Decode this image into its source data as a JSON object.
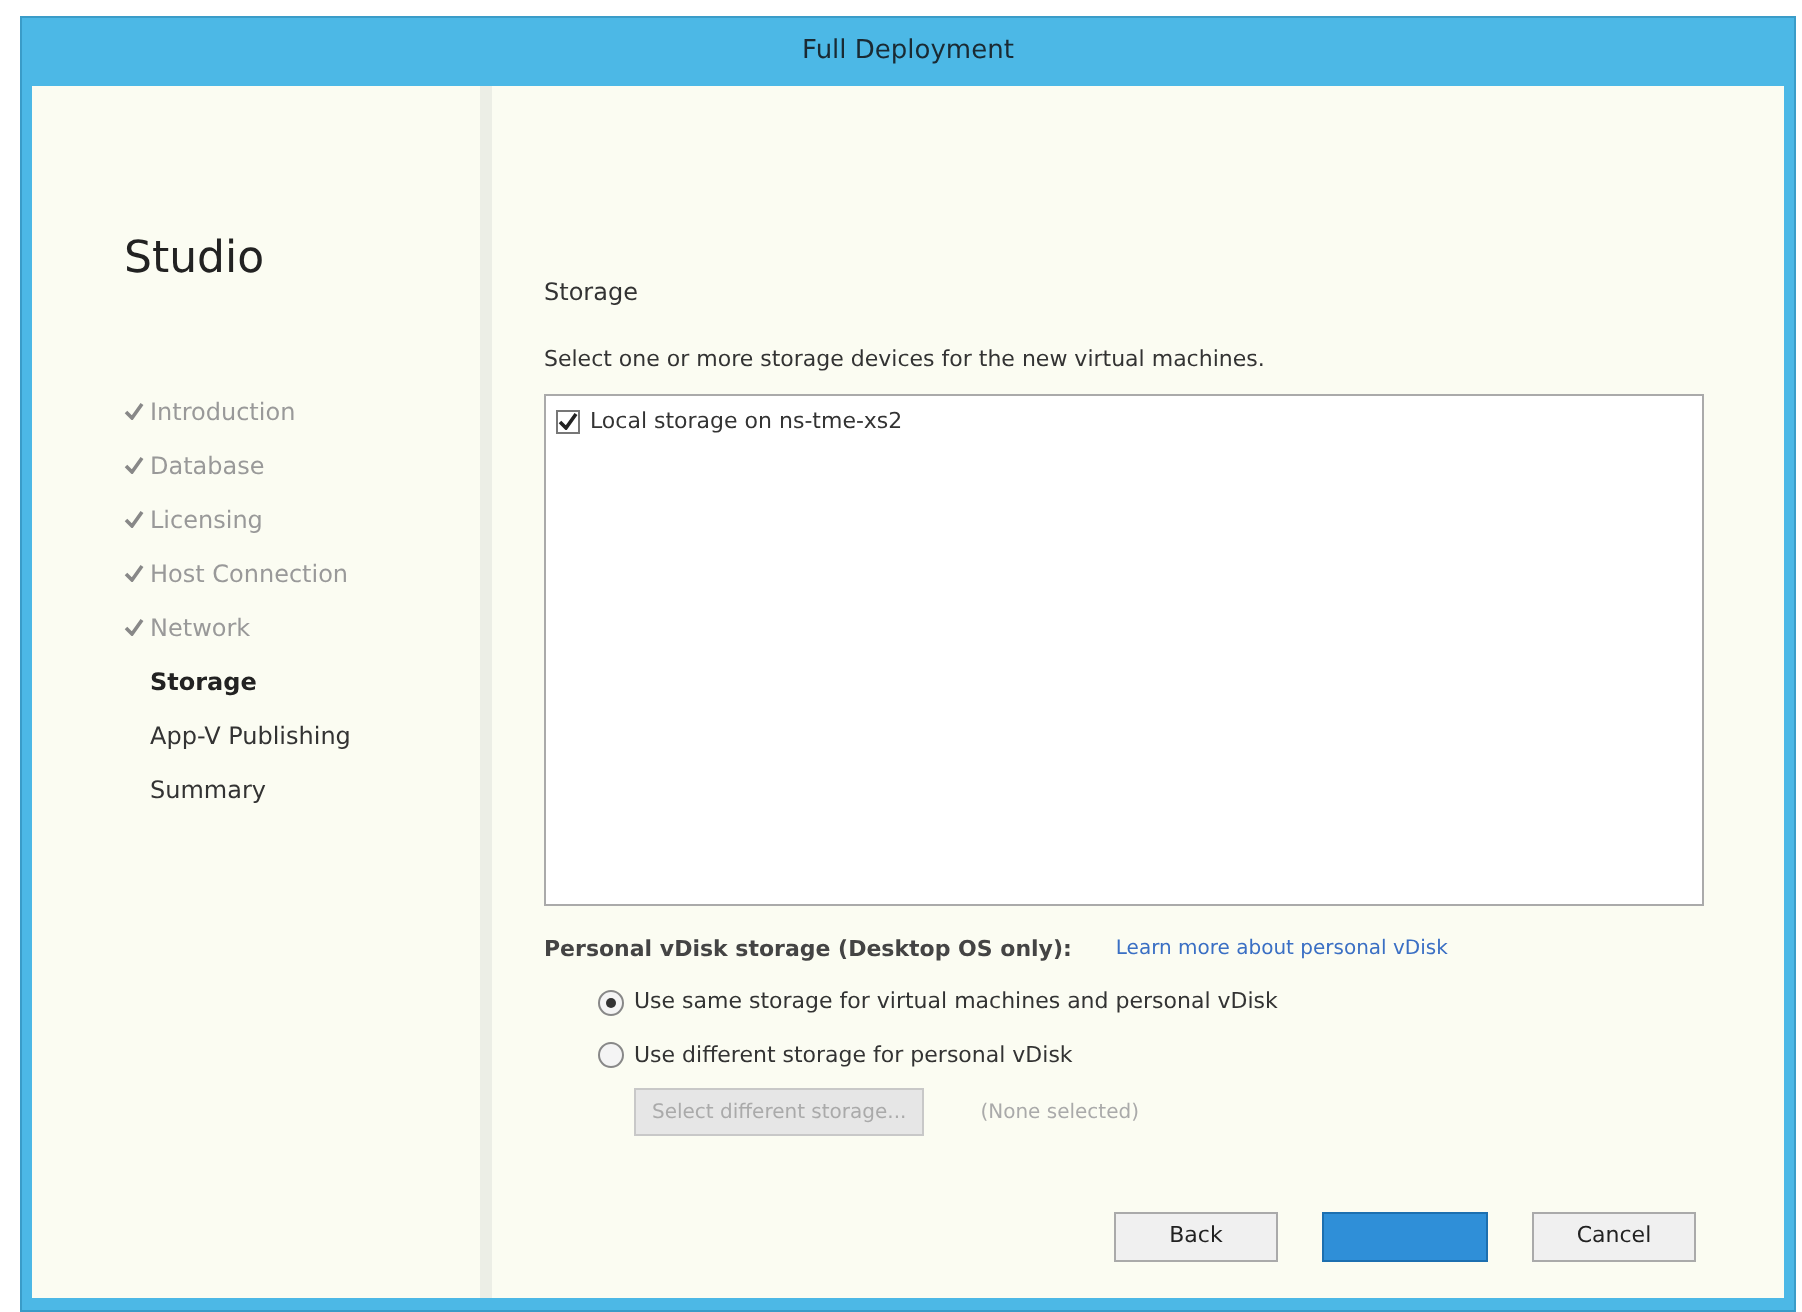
{
  "window": {
    "title": "Full Deployment"
  },
  "sidebar": {
    "title": "Studio",
    "steps": [
      {
        "label": "Introduction",
        "completed": true,
        "selected": false
      },
      {
        "label": "Database",
        "completed": true,
        "selected": false
      },
      {
        "label": "Licensing",
        "completed": true,
        "selected": false
      },
      {
        "label": "Host Connection",
        "completed": true,
        "selected": false
      },
      {
        "label": "Network",
        "completed": true,
        "selected": false
      },
      {
        "label": "Storage",
        "completed": false,
        "selected": true
      },
      {
        "label": "App-V Publishing",
        "completed": false,
        "selected": false
      },
      {
        "label": "Summary",
        "completed": false,
        "selected": false
      }
    ]
  },
  "content": {
    "heading": "Storage",
    "instruction": "Select one or more storage devices for the new virtual machines.",
    "storage_list": [
      {
        "label": "Local storage on ns-tme-xs2",
        "checked": true
      }
    ],
    "vdisk": {
      "heading": "Personal vDisk storage (Desktop OS only):",
      "link": "Learn more about personal vDisk",
      "options": [
        {
          "label": "Use same storage for virtual machines and personal vDisk",
          "selected": true
        },
        {
          "label": "Use different storage for personal vDisk",
          "selected": false
        }
      ],
      "select_button": {
        "label": "Select different storage...",
        "disabled": true
      },
      "selection": "(None selected)"
    }
  },
  "buttons": [
    {
      "label": "Back",
      "kind": "normal"
    },
    {
      "kind": "primary"
    },
    {
      "label": "Cancel",
      "kind": "normal"
    }
  ]
}
